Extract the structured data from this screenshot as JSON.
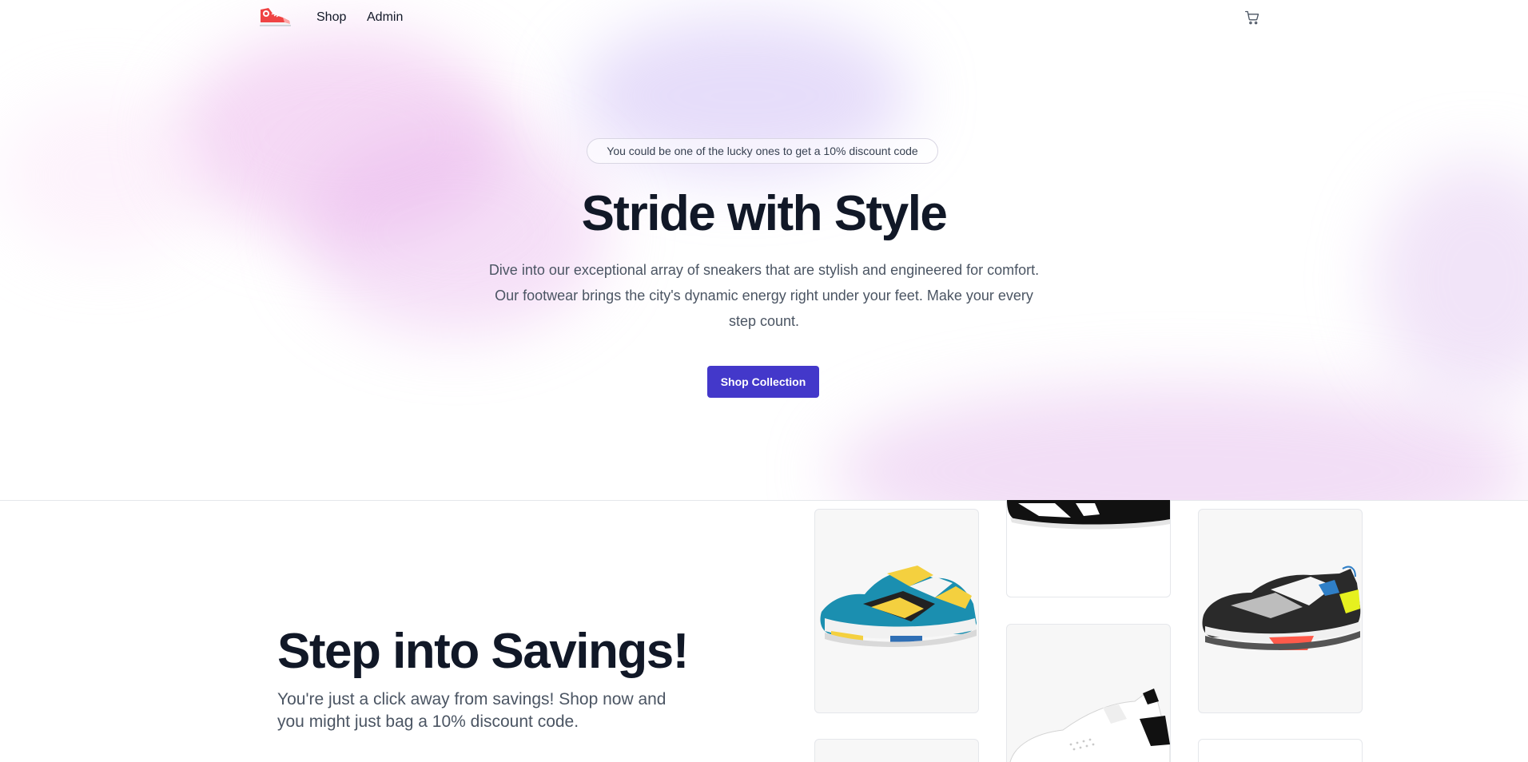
{
  "nav": {
    "logo_alt": "sneaker-logo",
    "links": [
      {
        "label": "Shop"
      },
      {
        "label": "Admin"
      }
    ],
    "cart_icon": "cart-icon"
  },
  "hero": {
    "badge_text": "You could be one of the lucky ones to get a 10% discount code",
    "title": "Stride with Style",
    "description": "Dive into our exceptional array of sneakers that are stylish and engineered for comfort. Our footwear brings the city's dynamic energy right under your feet. Make your every step count.",
    "cta_label": "Shop Collection"
  },
  "savings": {
    "title": "Step into Savings!",
    "description": "You're just a click away from savings! Shop now and you might just bag a 10% discount code."
  },
  "colors": {
    "primary": "#4338ca",
    "text_dark": "#111827",
    "text_muted": "#4b5563"
  }
}
